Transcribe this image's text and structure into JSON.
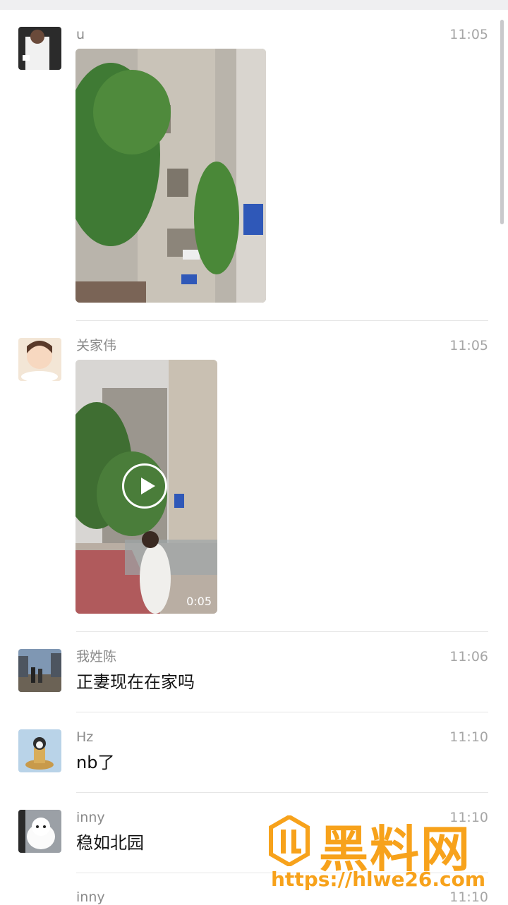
{
  "messages": [
    {
      "sender": "u",
      "time": "11:05"
    },
    {
      "sender": "关家伟",
      "time": "11:05",
      "video_duration": "0:05"
    },
    {
      "sender": "我姓陈",
      "time": "11:06",
      "text": "正妻现在在家吗"
    },
    {
      "sender": "Hz",
      "time": "11:10",
      "text": "nb了"
    },
    {
      "sender": "inny",
      "time": "11:10",
      "text": "稳如北园"
    },
    {
      "sender": "inny",
      "time": "11:10"
    }
  ],
  "watermark": {
    "brand": "黑料网",
    "url": "https://hlwe26.com"
  },
  "colors": {
    "accent": "#f7a21b",
    "divider": "#e6e6e6",
    "meta_text": "#8a8a8a"
  }
}
